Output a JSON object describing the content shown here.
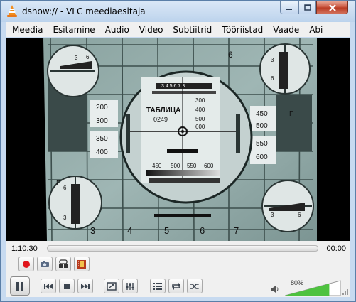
{
  "window": {
    "title": "dshow:// - VLC meediaesitaja"
  },
  "menu": {
    "items": [
      {
        "label": "Meedia",
        "key": "media"
      },
      {
        "label": "Esitamine",
        "key": "playback"
      },
      {
        "label": "Audio",
        "key": "audio"
      },
      {
        "label": "Video",
        "key": "video"
      },
      {
        "label": "Subtiitrid",
        "key": "subtitles"
      },
      {
        "label": "Tööriistad",
        "key": "tools"
      },
      {
        "label": "Vaade",
        "key": "view"
      },
      {
        "label": "Abi",
        "key": "help"
      }
    ]
  },
  "video_frame": {
    "test_card_label": "ТАБЛИЦА",
    "test_card_number": "0249",
    "digits_top": "3 4 5 6 7 8",
    "center_right_numbers": [
      "300",
      "400",
      "500",
      "600"
    ],
    "lower_numbers": [
      "450",
      "500",
      "550",
      "600"
    ],
    "left_block_numbers": [
      "200",
      "300",
      "350",
      "400"
    ],
    "right_block_numbers": [
      "450",
      "500",
      "550",
      "600"
    ],
    "bottom_cells": [
      "3",
      "4",
      "5",
      "6",
      "7"
    ],
    "top_cell": "6",
    "corner_numbers": [
      "3",
      "4",
      "5",
      "6"
    ],
    "side_letter": "Г"
  },
  "playback": {
    "elapsed": "1:10:30",
    "total": "00:00",
    "position_fraction": 0.0
  },
  "volume": {
    "percent_label": "80%",
    "level": 0.8
  },
  "colors": {
    "record": "#e0141b",
    "volume_fill": "#4ec23f",
    "chrome": "#bcd5ee"
  }
}
